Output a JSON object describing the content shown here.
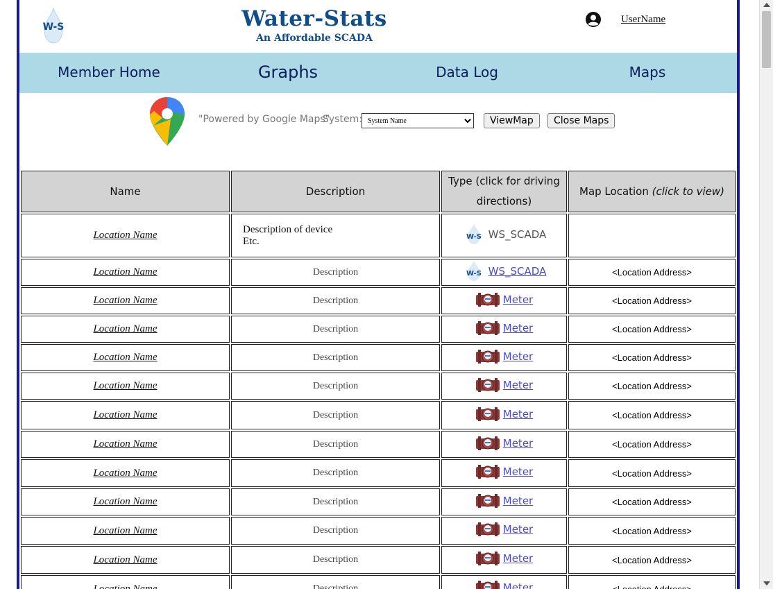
{
  "header": {
    "logo_text": "W-S",
    "title": "Water-Stats",
    "subtitle": "An Affordable SCADA",
    "username": "UserName"
  },
  "nav": {
    "items": [
      {
        "label": "Member Home"
      },
      {
        "label": "Graphs"
      },
      {
        "label": "Data Log"
      },
      {
        "label": "Maps"
      }
    ]
  },
  "maps_toolbar": {
    "powered_by": "\"Powered by Google Maps\"",
    "system_label": "System:",
    "system_selected": "System Name",
    "view_map_label": "ViewMap",
    "close_maps_label": "Close Maps"
  },
  "table": {
    "headers": {
      "name": "Name",
      "description": "Description",
      "type": "Type (click for driving directions)",
      "map_location_main": "Map Location ",
      "map_location_hint": "(click to view)"
    },
    "first_row": {
      "name": "Location Name",
      "description_line1": "Description of device",
      "description_line2": "Etc.",
      "type_label": "WS_SCADA",
      "address": ""
    },
    "rows": [
      {
        "name": "Location Name",
        "description": "Description",
        "type_label": "WS_SCADA",
        "address": "<Location Address>"
      },
      {
        "name": "Location Name",
        "description": "Description",
        "type_label": "Meter",
        "address": "<Location Address>"
      },
      {
        "name": "Location Name",
        "description": "Description",
        "type_label": "Meter",
        "address": "<Location Address>"
      },
      {
        "name": "Location Name",
        "description": "Description",
        "type_label": "Meter",
        "address": "<Location Address>"
      },
      {
        "name": "Location Name",
        "description": "Description",
        "type_label": "Meter",
        "address": "<Location Address>"
      },
      {
        "name": "Location Name",
        "description": "Description",
        "type_label": "Meter",
        "address": "<Location Address>"
      },
      {
        "name": "Location Name",
        "description": "Description",
        "type_label": "Meter",
        "address": "<Location Address>"
      },
      {
        "name": "Location Name",
        "description": "Description",
        "type_label": "Meter",
        "address": "<Location Address>"
      },
      {
        "name": "Location Name",
        "description": "Description",
        "type_label": "Meter",
        "address": "<Location Address>"
      },
      {
        "name": "Location Name",
        "description": "Description",
        "type_label": "Meter",
        "address": "<Location Address>"
      },
      {
        "name": "Location Name",
        "description": "Description",
        "type_label": "Meter",
        "address": "<Location Address>"
      },
      {
        "name": "Location Name",
        "description": "Description",
        "type_label": "Meter",
        "address": "<Location Address>"
      }
    ]
  },
  "colors": {
    "brand": "#0f4d8a",
    "nav_bg": "#add8e6",
    "border": "#1a1a8c",
    "link": "#4a4ad0"
  },
  "icons": {
    "logo": "ws-drop-logo-icon",
    "user": "user-avatar-icon",
    "maps_pin": "google-maps-pin-icon",
    "ws_scada": "ws-scada-icon",
    "meter": "meter-icon"
  }
}
